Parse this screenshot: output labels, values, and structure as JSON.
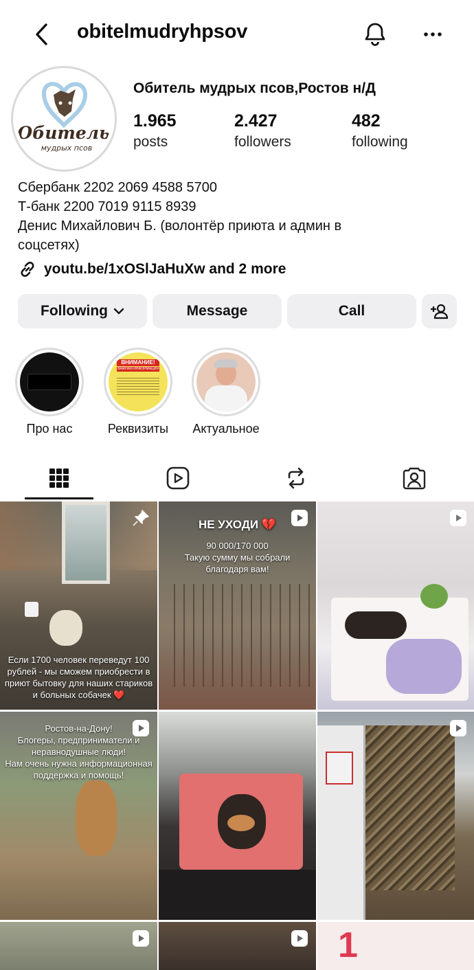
{
  "header": {
    "username": "obitelmudryhpsov",
    "display_name": "Обитель мудрых псов,Ростов н/Д"
  },
  "stats": [
    {
      "value": "1.965",
      "label": "posts"
    },
    {
      "value": "2.427",
      "label": "followers"
    },
    {
      "value": "482",
      "label": "following"
    }
  ],
  "avatar": {
    "text_line1": "Обитель",
    "text_line2": "мудрых псов"
  },
  "bio": [
    "Сбербанк 2202 2069 4588 5700",
    "Т-банк 2200 7019 9115 8939",
    "Денис Михайлович Б. (волонтёр приюта и админ в",
    "соцсетях)"
  ],
  "link": "youtu.be/1xOSlJaHuXw and 2 more",
  "actions": {
    "following": "Following",
    "message": "Message",
    "call": "Call"
  },
  "highlights": [
    {
      "label": "Про нас"
    },
    {
      "label": "Реквизиты",
      "banner": "ВНИМАНИЕ!",
      "sub": "ВАЖНАЯ ИНФОРМАЦИЯ"
    },
    {
      "label": "Актуальное"
    }
  ],
  "posts": [
    {
      "caption": "Если 1700 человек переведут 100 рублей - мы сможем приобрести в приют бытовку для наших стариков и больных собачек ❤️"
    },
    {
      "title": "НЕ УХОДИ 💔",
      "caption": "90 000/170 000\nТакую сумму мы собрали благодаря вам!"
    },
    {},
    {
      "caption": "Ростов-на-Дону!\nБлогеры, предприниматели и неравнодушные люди!\nНам очень нужна информационная поддержка и помощь!"
    },
    {},
    {},
    {},
    {},
    {
      "label_big": "1"
    }
  ],
  "colors": {
    "button_bg": "#efeff1",
    "text": "#0c0c0c"
  }
}
